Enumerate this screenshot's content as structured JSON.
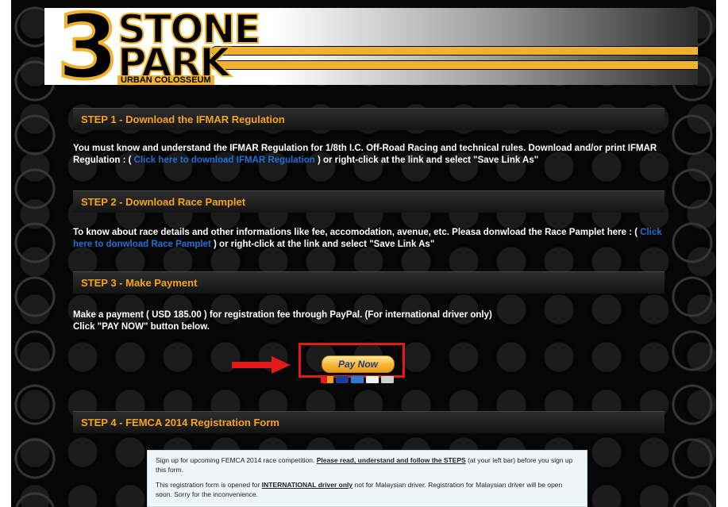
{
  "header": {
    "logo_numeral": "3",
    "logo_line1": "STONE",
    "logo_line2": "PARK",
    "logo_sub": "URBAN COLOSSEUM"
  },
  "steps": [
    {
      "title": "STEP 1 - Download the IFMAR Regulation",
      "text_before": "You must know and understand the IFMAR Regulation for 1/8th I.C. Off-Road Racing and technical rules. Download and/or print IFMAR Regulation : ( ",
      "link": "Click here to download IFMAR Regulation",
      "text_after": " ) or right-click at the link and select \"Save Link As\""
    },
    {
      "title": "STEP 2 - Download Race Pamplet",
      "text_before": "To know about race details and other informations like fee, accomodation, avenue, etc. Pleasa donwload the Race Pamplet here : ( ",
      "link": "Click here to donwload Race Pamplet",
      "text_after": " ) or right-click at the link and select \"Save Link As\""
    },
    {
      "title": "STEP 3 - Make Payment",
      "line1": "Make a payment ( USD 185.00 ) for registration fee through PayPal. (For international driver only)",
      "line2": "Click \"PAY NOW\" button below.",
      "pay_button": "Pay Now"
    },
    {
      "title": "STEP 4 - FEMCA 2014 Registration Form"
    }
  ],
  "form": {
    "p1_before": "Sign up for upcoming FEMCA 2014 race competition. ",
    "p1_emph": "Please read, understand and follow the STEPS",
    "p1_after": " (at your left bar) before you sign up this form.",
    "p2_before": "This registration form is opened for ",
    "p2_emph": "INTERNATIONAL driver only",
    "p2_after": " not for Malaysian driver. Registration for Malaysian driver will be open soon. Sorry for the inconvenience."
  },
  "colors": {
    "accent": "#f5a31a",
    "link": "#1f6fd6",
    "highlight_frame": "#e31a1a",
    "logo_yellow": "#f0b22a"
  },
  "card_icons": [
    "mastercard-icon",
    "visa-icon",
    "amex-icon",
    "discover-icon",
    "echeck-icon"
  ]
}
